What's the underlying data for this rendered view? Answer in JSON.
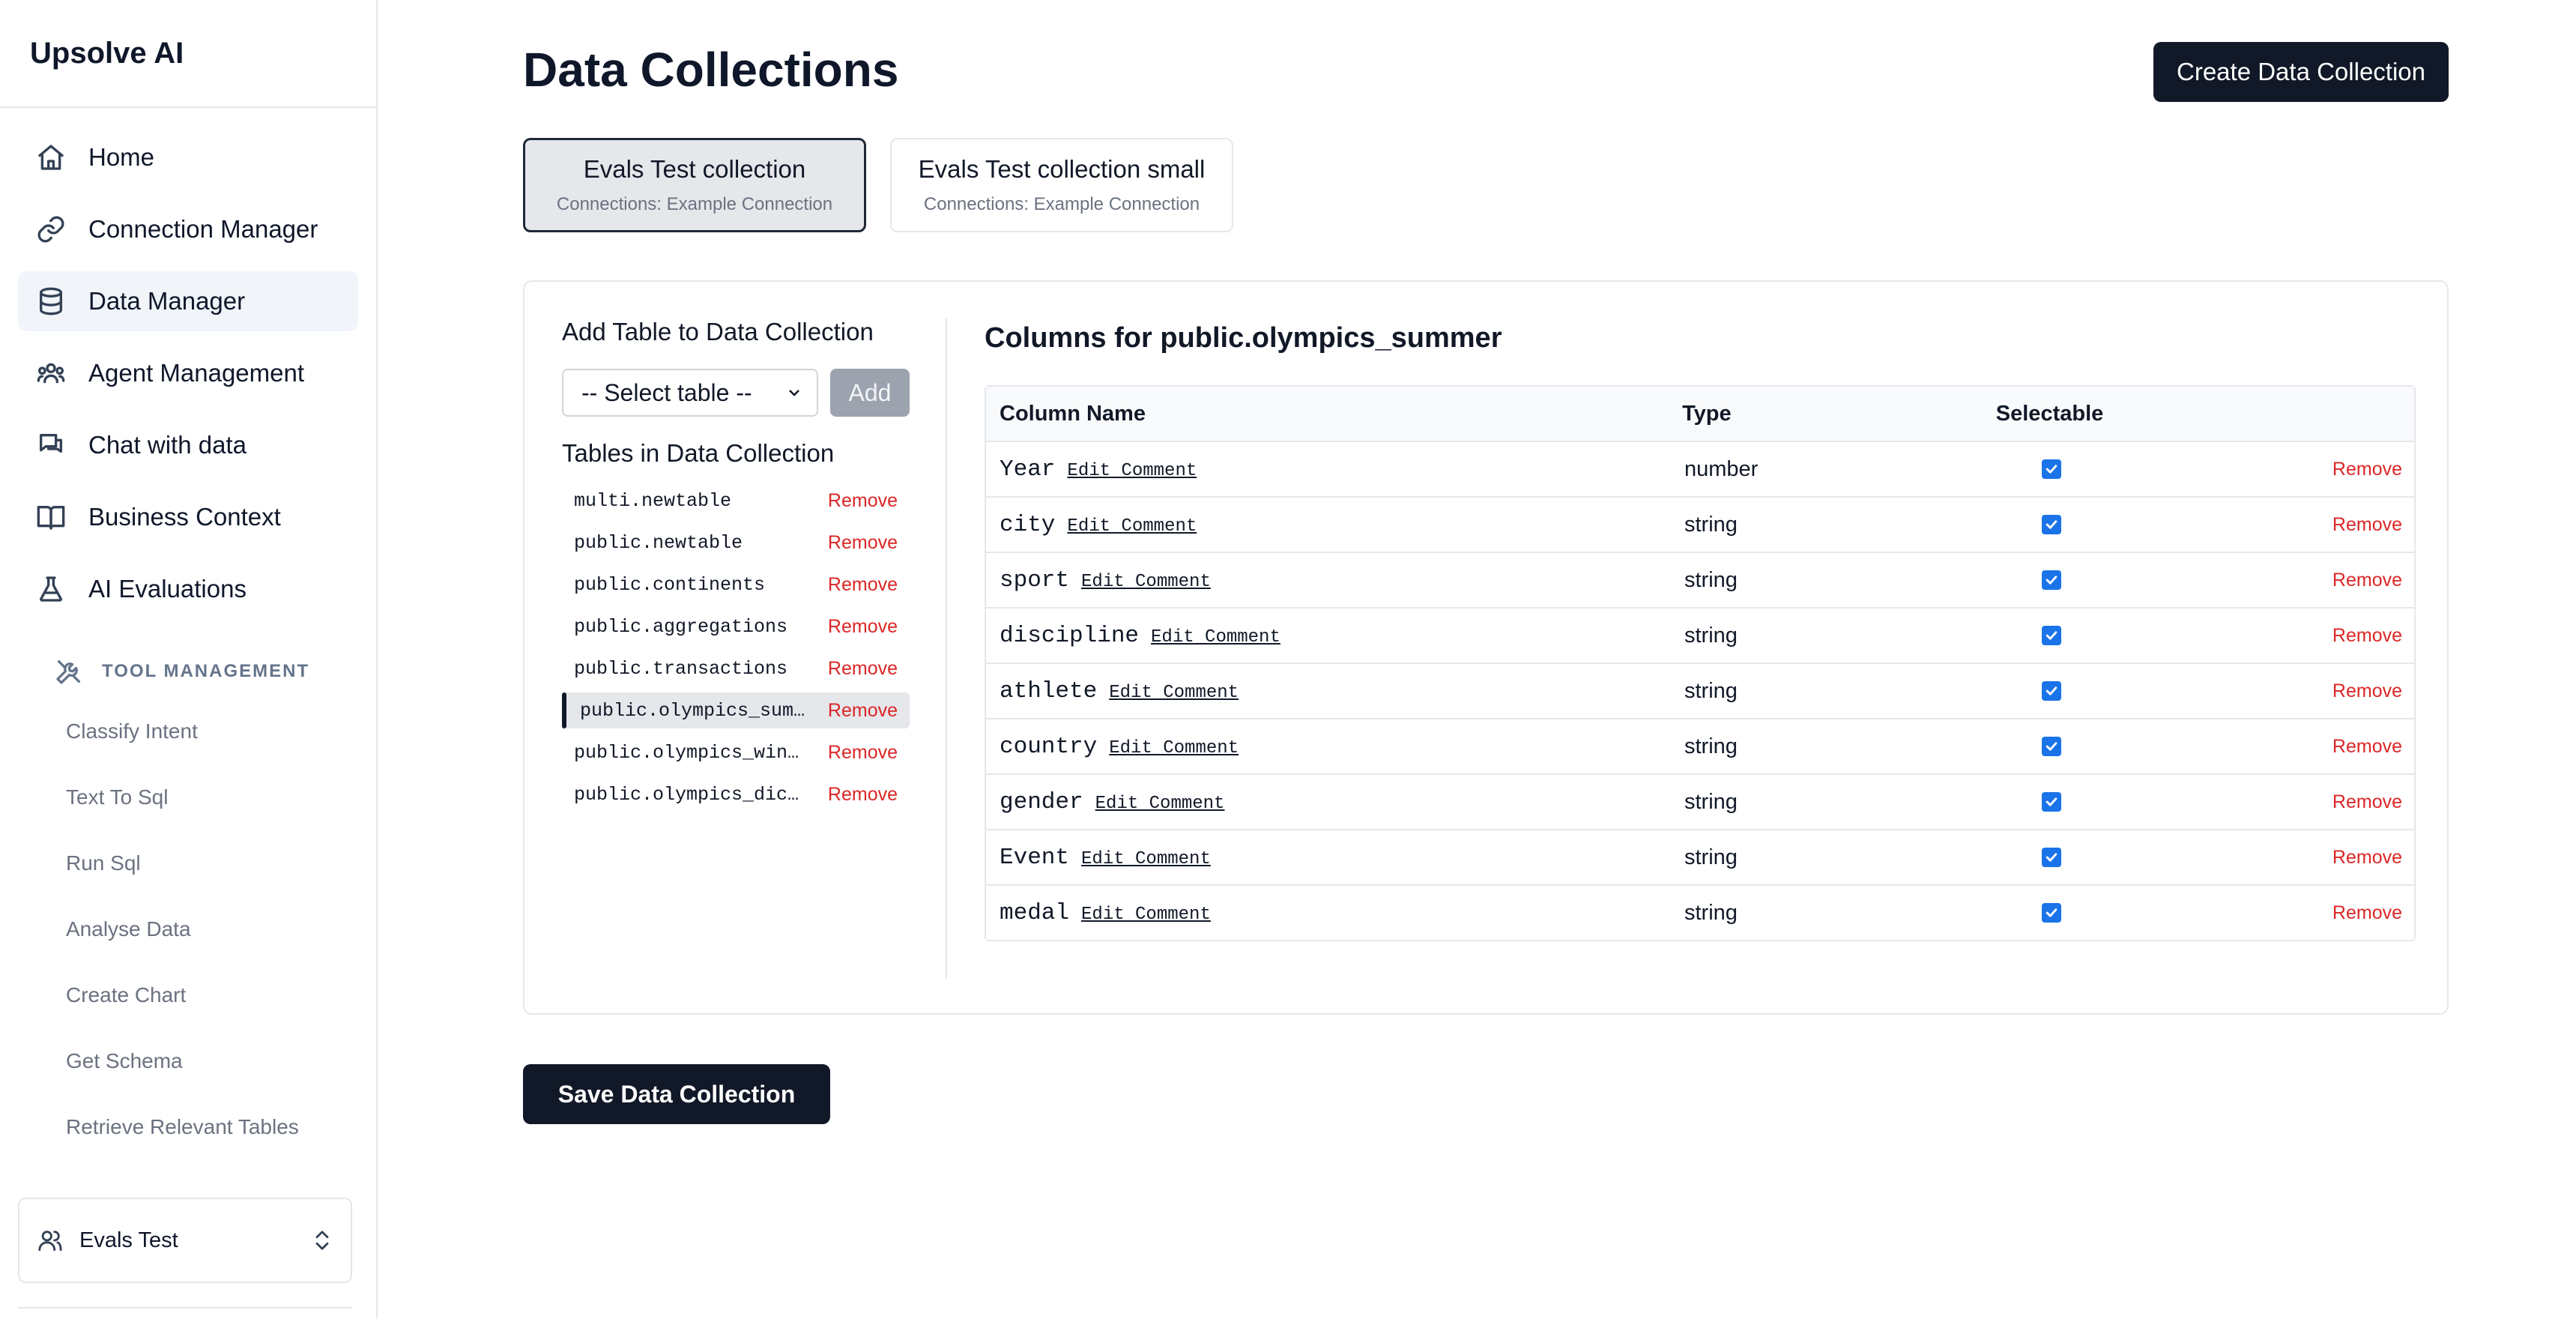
{
  "app": {
    "brand": "Upsolve AI"
  },
  "sidebar": {
    "items": [
      {
        "label": "Home",
        "icon": "home-icon",
        "active": false
      },
      {
        "label": "Connection Manager",
        "icon": "link-icon",
        "active": false
      },
      {
        "label": "Data Manager",
        "icon": "database-icon",
        "active": true
      },
      {
        "label": "Agent Management",
        "icon": "users-icon",
        "active": false
      },
      {
        "label": "Chat with data",
        "icon": "chat-icon",
        "active": false
      },
      {
        "label": "Business Context",
        "icon": "book-icon",
        "active": false
      },
      {
        "label": "AI Evaluations",
        "icon": "flask-icon",
        "active": false
      }
    ],
    "tool_section": {
      "heading": "TOOL MANAGEMENT",
      "icon": "tools-icon",
      "items": [
        "Classify Intent",
        "Text To Sql",
        "Run Sql",
        "Analyse Data",
        "Create Chart",
        "Get Schema",
        "Retrieve Relevant Tables"
      ]
    },
    "org": {
      "name": "Evals Test",
      "icon": "user-icon"
    }
  },
  "main": {
    "title": "Data Collections",
    "create_label": "Create Data Collection",
    "collections": [
      {
        "name": "Evals Test collection",
        "connections": "Connections: Example Connection",
        "selected": true
      },
      {
        "name": "Evals Test collection small",
        "connections": "Connections: Example Connection",
        "selected": false
      }
    ],
    "add_table": {
      "heading": "Add Table to Data Collection",
      "select_value": "-- Select table --",
      "add_label": "Add"
    },
    "tables": {
      "heading": "Tables in Data Collection",
      "remove_label": "Remove",
      "items": [
        {
          "name": "multi.newtable",
          "active": false
        },
        {
          "name": "public.newtable",
          "active": false
        },
        {
          "name": "public.continents",
          "active": false
        },
        {
          "name": "public.aggregations",
          "active": false
        },
        {
          "name": "public.transactions",
          "active": false
        },
        {
          "name": "public.olympics_summer",
          "active": true
        },
        {
          "name": "public.olympics_winter",
          "active": false
        },
        {
          "name": "public.olympics_dictionary",
          "active": false
        }
      ]
    },
    "columns": {
      "heading": "Columns for public.olympics_summer",
      "headers": {
        "name": "Column Name",
        "type": "Type",
        "selectable": "Selectable"
      },
      "edit_label": "Edit Comment",
      "remove_label": "Remove",
      "rows": [
        {
          "name": "Year",
          "type": "number",
          "selectable": true
        },
        {
          "name": "city",
          "type": "string",
          "selectable": true
        },
        {
          "name": "sport",
          "type": "string",
          "selectable": true
        },
        {
          "name": "discipline",
          "type": "string",
          "selectable": true
        },
        {
          "name": "athlete",
          "type": "string",
          "selectable": true
        },
        {
          "name": "country",
          "type": "string",
          "selectable": true
        },
        {
          "name": "gender",
          "type": "string",
          "selectable": true
        },
        {
          "name": "Event",
          "type": "string",
          "selectable": true
        },
        {
          "name": "medal",
          "type": "string",
          "selectable": true
        }
      ]
    },
    "save_label": "Save Data Collection"
  }
}
